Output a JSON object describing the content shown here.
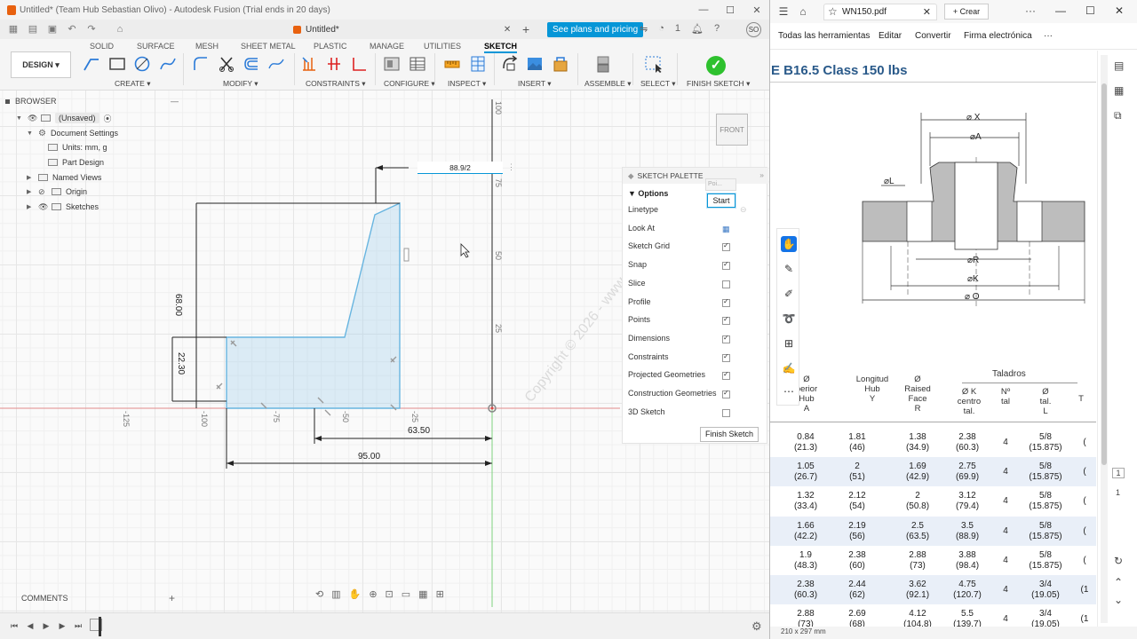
{
  "fusion": {
    "window_title": "Untitled* (Team Hub Sebastian Olivo) - Autodesk Fusion (Trial ends in 20 days)",
    "doc_tab": "Untitled*",
    "plans_button": "See plans and pricing",
    "notifications_count": "1",
    "user_initials": "SO",
    "toolbar_tabs": [
      "SOLID",
      "SURFACE",
      "MESH",
      "SHEET METAL",
      "PLASTIC",
      "MANAGE",
      "UTILITIES",
      "SKETCH"
    ],
    "active_tab": "SKETCH",
    "workspace": "DESIGN",
    "groups": [
      "CREATE",
      "MODIFY",
      "CONSTRAINTS",
      "CONFIGURE",
      "INSPECT",
      "INSERT",
      "ASSEMBLE",
      "SELECT",
      "FINISH SKETCH"
    ],
    "browser": {
      "title": "BROWSER",
      "items": [
        "(Unsaved)",
        "Document Settings",
        "Units: mm, g",
        "Part Design",
        "Named Views",
        "Origin",
        "Sketches"
      ]
    },
    "comments_label": "COMMENTS",
    "viewcube_label": "FRONT",
    "dimension_input_value": "88.9/2",
    "dimensions": {
      "width_total": "95.00",
      "width_inner": "63.50",
      "height_total": "68.00",
      "height_lower": "22.30"
    },
    "axis_ticks_x": [
      "-125",
      "-100",
      "-75",
      "-50",
      "-25"
    ],
    "axis_ticks_y": [
      "100",
      "75",
      "50",
      "25"
    ],
    "sketch_palette": {
      "title": "SKETCH PALETTE",
      "section": "Options",
      "rows": [
        {
          "label": "Linetype",
          "checked": null
        },
        {
          "label": "Look At",
          "checked": null
        },
        {
          "label": "Sketch Grid",
          "checked": true
        },
        {
          "label": "Snap",
          "checked": true
        },
        {
          "label": "Slice",
          "checked": false
        },
        {
          "label": "Profile",
          "checked": true
        },
        {
          "label": "Points",
          "checked": true
        },
        {
          "label": "Dimensions",
          "checked": true
        },
        {
          "label": "Constraints",
          "checked": true
        },
        {
          "label": "Projected Geometries",
          "checked": true
        },
        {
          "label": "Construction Geometries",
          "checked": true
        },
        {
          "label": "3D Sketch",
          "checked": false
        }
      ],
      "finish_button": "Finish Sketch",
      "start_button": "Start",
      "tooltip_text": "Poi..."
    },
    "watermark": "Copyright © 2026 - www.p30download.ir"
  },
  "pdf": {
    "tab_title": "WN150.pdf",
    "crear_button": "Crear",
    "menu": [
      "Todas las herramientas",
      "Editar",
      "Convertir",
      "Firma electrónica"
    ],
    "heading": "E B16.5 Class 150 lbs",
    "drawing_labels": [
      "⌀ X",
      "⌀A",
      "⌀L",
      "⌀R",
      "⌀K",
      "⌀ O"
    ],
    "table": {
      "headers": [
        {
          "lines": [
            "Ø",
            "perior",
            "Hub",
            "A"
          ]
        },
        {
          "lines": [
            "Longitud",
            "Hub",
            "Y"
          ]
        },
        {
          "lines": [
            "Ø",
            "Raised",
            "Face",
            "R"
          ]
        },
        {
          "lines": [
            "Ø K",
            "centro",
            "tal."
          ]
        },
        {
          "lines": [
            "Nº",
            "tal"
          ]
        },
        {
          "lines": [
            "Ø",
            "tal.",
            "L"
          ]
        },
        {
          "lines": [
            "T"
          ]
        }
      ],
      "group_header": "Taladros",
      "rows": [
        [
          "0.84\n(21.3)",
          "1.81\n(46)",
          "1.38\n(34.9)",
          "2.38\n(60.3)",
          "4",
          "5/8\n(15.875)",
          "("
        ],
        [
          "1.05\n(26.7)",
          "2\n(51)",
          "1.69\n(42.9)",
          "2.75\n(69.9)",
          "4",
          "5/8\n(15.875)",
          "("
        ],
        [
          "1.32\n(33.4)",
          "2.12\n(54)",
          "2\n(50.8)",
          "3.12\n(79.4)",
          "4",
          "5/8\n(15.875)",
          "("
        ],
        [
          "1.66\n(42.2)",
          "2.19\n(56)",
          "2.5\n(63.5)",
          "3.5\n(88.9)",
          "4",
          "5/8\n(15.875)",
          "("
        ],
        [
          "1.9\n(48.3)",
          "2.38\n(60)",
          "2.88\n(73)",
          "3.88\n(98.4)",
          "4",
          "5/8\n(15.875)",
          "("
        ],
        [
          "2.38\n(60.3)",
          "2.44\n(62)",
          "3.62\n(92.1)",
          "4.75\n(120.7)",
          "4",
          "3/4\n(19.05)",
          "(1"
        ],
        [
          "2.88\n(73)",
          "2.69\n(68)",
          "4.12\n(104.8)",
          "5.5\n(139.7)",
          "4",
          "3/4\n(19.05)",
          "(1"
        ]
      ]
    },
    "page_size": "210 x 297 mm",
    "page_number": "1",
    "page_total": "1"
  }
}
